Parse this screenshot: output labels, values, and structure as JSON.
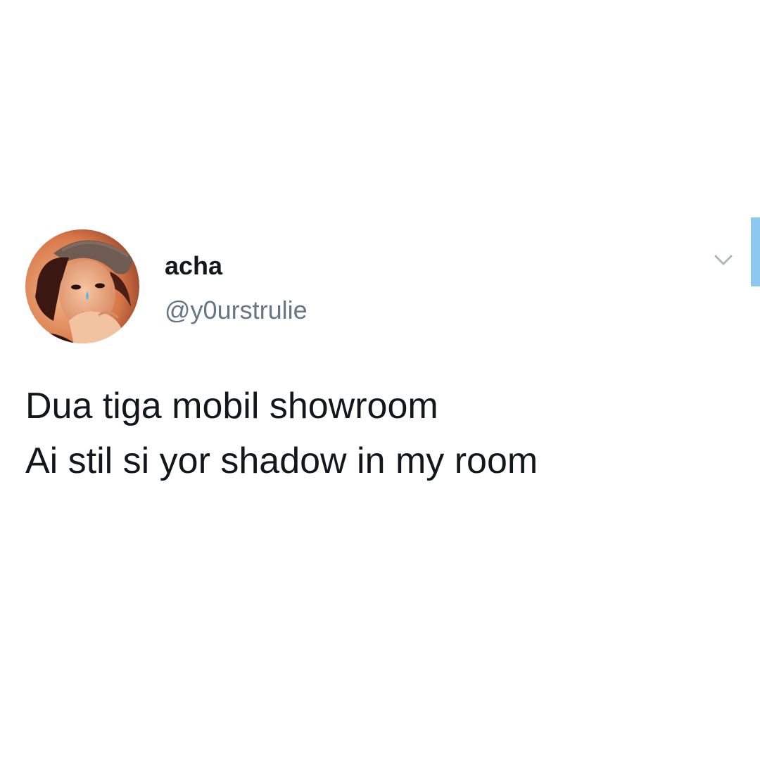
{
  "tweet": {
    "author": {
      "display_name": "acha",
      "handle": "@y0urstrulie",
      "avatar_icon": "profile-photo",
      "has_tear_emoji": true
    },
    "menu_icon": "chevron-down-icon",
    "text_lines": [
      "Dua tiga mobil showroom",
      "Ai stil si yor shadow in my room"
    ]
  },
  "colors": {
    "name": "#14171a",
    "handle": "#657786",
    "caret": "#aab8c2",
    "scroll_indicator": "#8cc8ef",
    "background": "#ffffff"
  }
}
